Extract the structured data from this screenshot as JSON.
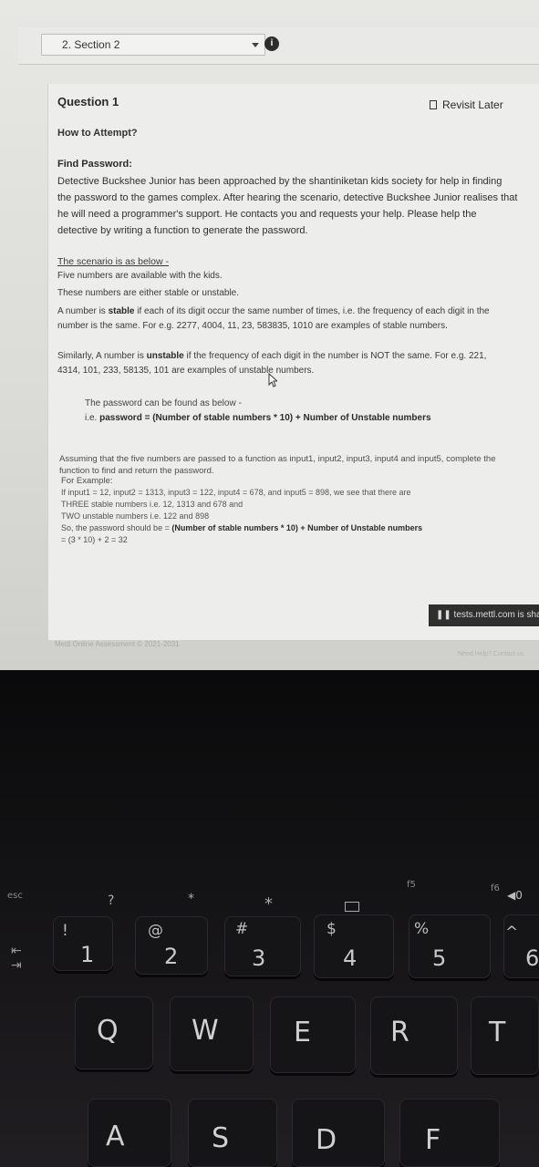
{
  "header": {
    "section_label": "2. Section 2",
    "info_icon": "info-icon"
  },
  "question": {
    "title": "Question 1",
    "revisit_label": "Revisit Later",
    "how_to_attempt": "How to Attempt?",
    "problem_title": "Find Password:",
    "intro": "Detective Buckshee Junior has been approached by the shantiniketan kids society for help in finding the password to the games complex. After hearing the scenario, detective Buckshee Junior realises that he will need a programmer's support. He contacts you and requests your help. Please help the detective by writing a function to generate the password.",
    "scenario_heading": "The scenario is as below -",
    "rule1": "Five numbers are available with the kids.",
    "rule2": "These numbers are either stable or unstable.",
    "stable_prefix": "A number is ",
    "stable_bold": "stable",
    "stable_rest": " if each of its digit occur the same number of times, i.e. the frequency of each digit in the number is the same. For e.g. 2277, 4004, 11, 23, 583835, 1010 are examples of stable numbers.",
    "unstable_prefix": "Similarly, A number is ",
    "unstable_bold": "unstable",
    "unstable_rest": " if the frequency of each digit in the number is NOT the same. For e.g. 221, 4314, 101, 233, 58135, 101 are examples of unstable numbers.",
    "password_intro": "The password can be found as below -",
    "password_prefix": "i.e. ",
    "password_formula": "password = (Number of stable numbers * 10) + Number of Unstable numbers",
    "assumption": "Assuming that the five numbers are passed to a function as input1, input2, input3, input4 and input5, complete the function to find and return the password.",
    "example_heading": "For Example:",
    "example_line1": "If input1 = 12, input2 = 1313, input3 = 122, input4 = 678, and input5 = 898, we see that there are",
    "example_line2": "THREE stable numbers i.e. 12, 1313 and 678 and",
    "example_line3": "TWO unstable numbers i.e. 122 and 898",
    "example_line4_prefix": "So, the password should be = ",
    "example_line4_bold": "(Number of stable numbers * 10) + Number of Unstable numbers",
    "example_line5": "= (3 * 10) + 2 = 32"
  },
  "footer": {
    "copyright": "Mettl Online Assessment © 2021-2031",
    "help": "Need Help? Contact us"
  },
  "notice": {
    "text": "tests.mettl.com is sharing your screen."
  },
  "keyboard": {
    "esc": "esc",
    "f1": "?",
    "f2": "*",
    "f3": "*",
    "f5": "f5",
    "f6": "f6",
    "f6_icon": "◀0",
    "keys_row1": [
      {
        "sym": "!",
        "main": "1"
      },
      {
        "sym": "@",
        "main": "2"
      },
      {
        "sym": "#",
        "main": "3"
      },
      {
        "sym": "$",
        "main": "4"
      },
      {
        "sym": "%",
        "main": "5"
      },
      {
        "sym": "^",
        "main": "6"
      }
    ],
    "keys_row2": [
      "Q",
      "W",
      "E",
      "R",
      "T"
    ],
    "keys_row3": [
      "A",
      "S",
      "D",
      "F"
    ]
  }
}
